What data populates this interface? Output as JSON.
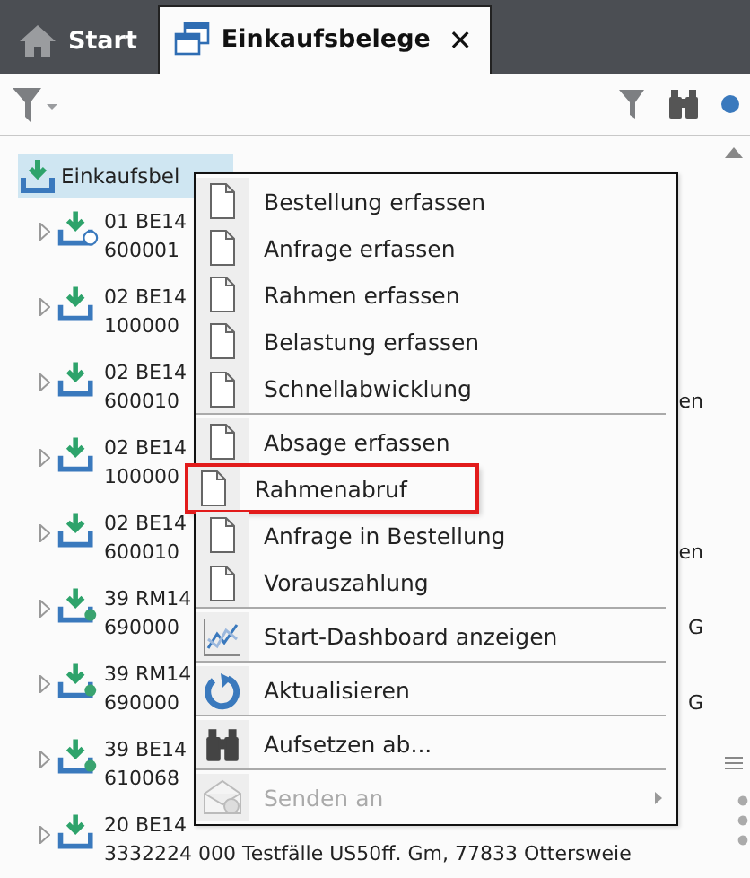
{
  "tabs": [
    {
      "label": "Start",
      "kind": "home",
      "selected": false,
      "closable": false
    },
    {
      "label": "Einkaufsbelege",
      "kind": "windows",
      "selected": true,
      "closable": true
    }
  ],
  "close_glyph": "✕",
  "tree": {
    "root": {
      "label": "Einkaufsbel",
      "selected": true
    },
    "children": [
      {
        "line1": "01 BE14",
        "line2": "600001",
        "kind": "ring"
      },
      {
        "line1": "02 BE14",
        "line2": "100000",
        "kind": "plain"
      },
      {
        "line1": "02 BE14",
        "line2": "600010",
        "tail2": "en",
        "kind": "plain"
      },
      {
        "line1": "02 BE14",
        "line2": "100000",
        "kind": "plain"
      },
      {
        "line1": "02 BE14",
        "line2": "600010",
        "tail2": "en",
        "kind": "plain"
      },
      {
        "line1": "39 RM14",
        "line2": "690000",
        "tail2": "G",
        "kind": "dot"
      },
      {
        "line1": "39 RM14",
        "line2": "690000",
        "tail2": "G",
        "kind": "dot"
      },
      {
        "line1": "39 BE14",
        "line2": "610068",
        "kind": "dot"
      },
      {
        "line1": "20 BE14",
        "line2": "3332224 000 Testfälle US50ff. Gm, 77833 Ottersweie",
        "kind": "plain"
      }
    ]
  },
  "context_menu": [
    {
      "label": "Bestellung erfassen",
      "kind": "document",
      "disabled": false,
      "highlighted": false,
      "submenu": false,
      "separator_after": false
    },
    {
      "label": "Anfrage erfassen",
      "kind": "document",
      "disabled": false,
      "highlighted": false,
      "submenu": false,
      "separator_after": false
    },
    {
      "label": "Rahmen erfassen",
      "kind": "document",
      "disabled": false,
      "highlighted": false,
      "submenu": false,
      "separator_after": false
    },
    {
      "label": "Belastung erfassen",
      "kind": "document",
      "disabled": false,
      "highlighted": false,
      "submenu": false,
      "separator_after": false
    },
    {
      "label": "Schnellabwicklung",
      "kind": "document",
      "disabled": false,
      "highlighted": false,
      "submenu": false,
      "separator_after": true
    },
    {
      "label": "Absage erfassen",
      "kind": "document",
      "disabled": false,
      "highlighted": false,
      "submenu": false,
      "separator_after": false
    },
    {
      "label": "Rahmenabruf",
      "kind": "document",
      "disabled": false,
      "highlighted": true,
      "submenu": false,
      "separator_after": false
    },
    {
      "label": "Anfrage in Bestellung",
      "kind": "document",
      "disabled": false,
      "highlighted": false,
      "submenu": false,
      "separator_after": false
    },
    {
      "label": "Vorauszahlung",
      "kind": "document",
      "disabled": false,
      "highlighted": false,
      "submenu": false,
      "separator_after": true
    },
    {
      "label": "Start-Dashboard anzeigen",
      "kind": "chart",
      "disabled": false,
      "highlighted": false,
      "submenu": false,
      "separator_after": true
    },
    {
      "label": "Aktualisieren",
      "kind": "refresh",
      "disabled": false,
      "highlighted": false,
      "submenu": false,
      "separator_after": true
    },
    {
      "label": "Aufsetzen ab...",
      "kind": "search",
      "disabled": false,
      "highlighted": false,
      "submenu": false,
      "separator_after": true
    },
    {
      "label": "Senden an",
      "kind": "send",
      "disabled": true,
      "highlighted": false,
      "submenu": true,
      "separator_after": false
    }
  ]
}
